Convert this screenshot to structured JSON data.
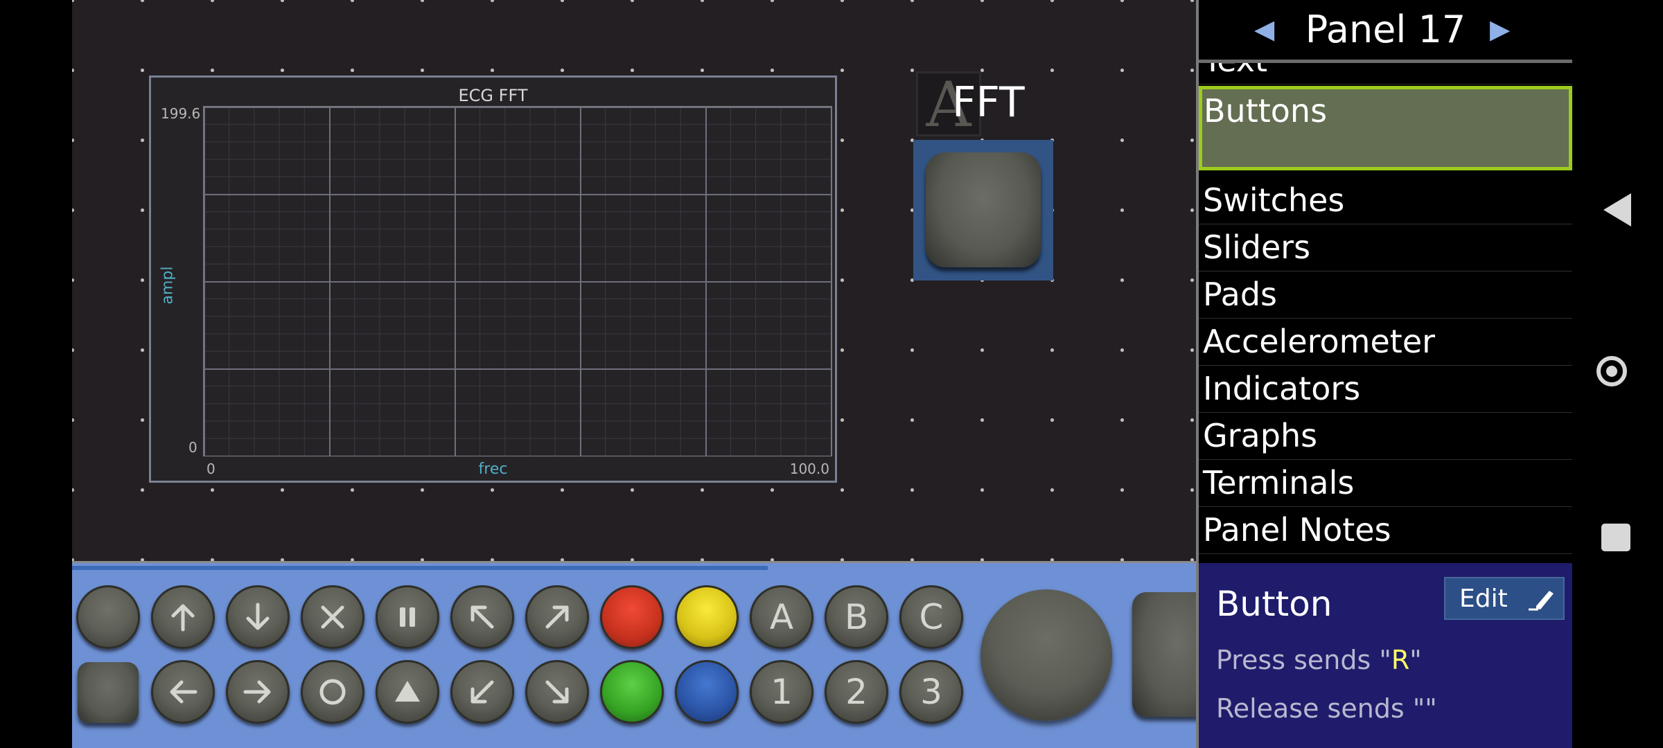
{
  "canvas": {
    "graph": {
      "title": "ECG FFT",
      "y_max": "199.6",
      "y_min": "0",
      "x_min": "0",
      "x_max": "100.0",
      "x_label": "frec",
      "y_label": "ampl"
    },
    "text_widget": {
      "glyph": "A",
      "value": "FFT"
    }
  },
  "panel": {
    "title": "Panel 17",
    "prev": "◀",
    "next": "▶"
  },
  "menu": {
    "items": [
      "Text",
      "Buttons",
      "Switches",
      "Sliders",
      "Pads",
      "Accelerometer",
      "Indicators",
      "Graphs",
      "Terminals",
      "Panel Notes"
    ],
    "selected": "Buttons"
  },
  "info": {
    "title": "Button",
    "edit_label": "Edit",
    "press_prefix": "Press sends \"",
    "press_value": "R",
    "press_suffix": "\"",
    "release_text": "Release sends \"\""
  },
  "palette": {
    "row1": [
      "plain",
      "up-arrow",
      "down-arrow",
      "x",
      "pause",
      "up-left-arrow",
      "up-right-arrow",
      "red",
      "yellow",
      "A",
      "B",
      "C"
    ],
    "row2": [
      "square",
      "left-arrow",
      "right-arrow",
      "circle",
      "triangle",
      "down-left-arrow",
      "down-right-arrow",
      "green",
      "blue",
      "1",
      "2",
      "3"
    ]
  },
  "colors": {
    "canvas_bg": "#231f23",
    "selected_border": "#9ccc1e",
    "info_bg": "#1f1c6b",
    "palette_bg": "#6e90d4",
    "accent_blue": "#8fb0e6"
  }
}
